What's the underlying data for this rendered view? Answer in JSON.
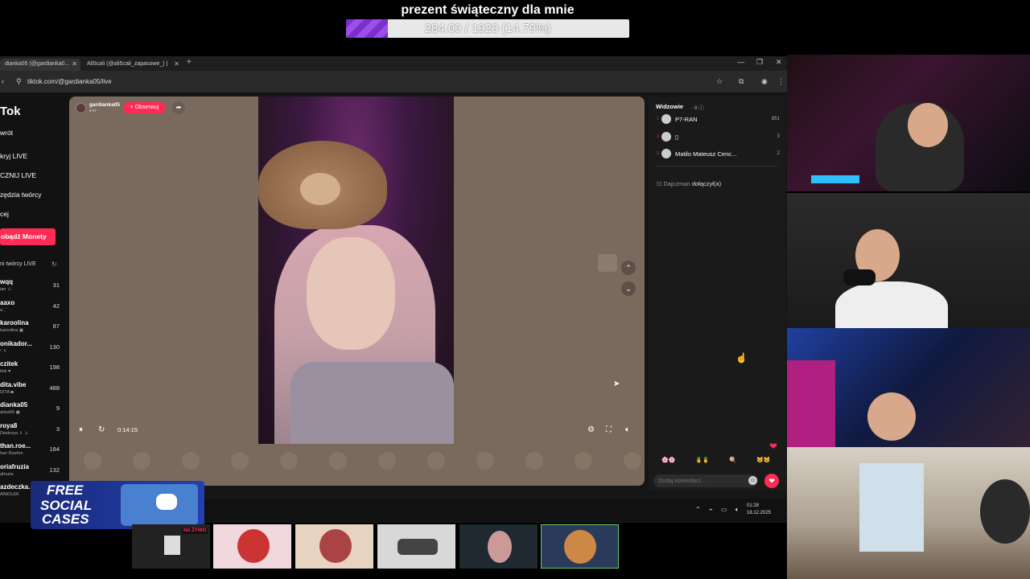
{
  "goal": {
    "title": "prezent świąteczny dla mnie",
    "text": "284.00 / 1920 (14.79%)",
    "progress": 0.1479
  },
  "browser": {
    "tabs": [
      {
        "label": "dianka05 (@gardianka0..."
      },
      {
        "label": "Ali5cali (@ali5cali_zapasowe_) |"
      }
    ],
    "url": "tiktok.com/@gardianka05/live"
  },
  "sidebar": {
    "logo": "Tok",
    "items": [
      {
        "label": "wrót"
      },
      {
        "label": "kryj LIVE"
      },
      {
        "label": "CZNIJ LIVE"
      },
      {
        "label": "zędzia twórcy"
      },
      {
        "label": "cej"
      }
    ],
    "coins_label": "obądź Monety",
    "creators_header": "ni twórcy LIVE",
    "creators": [
      {
        "name": "wqq",
        "sub": "ian ☺",
        "count": "31"
      },
      {
        "name": "aaxo",
        "sub": "a˙ꞈˇ",
        "count": "42"
      },
      {
        "name": "karoolina",
        "sub": "karoolina ▣",
        "count": "87"
      },
      {
        "name": "onikador...",
        "sub": "ᵒ ♗",
        "count": "130"
      },
      {
        "name": "czitek",
        "sub": "itek ♥",
        "count": "198"
      },
      {
        "name": "dita.vibe",
        "sub": "DITA ◙",
        "count": "488"
      },
      {
        "name": "dianka05",
        "sub": "anka05 ▣",
        "count": "9"
      },
      {
        "name": "roya8",
        "sub": "Destroya ♗ ☺",
        "count": "3"
      },
      {
        "name": "than.roe...",
        "sub": "han Roehm",
        "count": "184"
      },
      {
        "name": "oriafruzia",
        "sub": "afruzia",
        "count": "132"
      },
      {
        "name": "azdeczka...",
        "sub": "ANIOLEK",
        "count": ""
      }
    ]
  },
  "player": {
    "host_name": "gardianka05",
    "host_likes": "♥ 67",
    "follow_label": "+ Obserwuj",
    "timecode": "0:14:15"
  },
  "chat": {
    "viewers_label": "Widzowie",
    "viewers_count": "· 8 ⓘ",
    "viewers": [
      {
        "rank": "1",
        "name": "P7-RAN",
        "score": "851"
      },
      {
        "rank": "2",
        "name": "▯",
        "score": "3"
      },
      {
        "rank": "3",
        "name": "Matilo Mateusz Cenc...",
        "score": "2"
      }
    ],
    "join_user": "Dajczman",
    "join_text": "dołączył(a)",
    "comment_placeholder": "Dodaj komentarz...",
    "reactions": [
      "🌸🌸",
      "🍍🍍",
      "🍭",
      "🐱🐱"
    ]
  },
  "taskbar": {
    "time": "01:28",
    "date": "18.12.2025"
  },
  "promo": {
    "line1": "FREE",
    "line2": "SOCIAL",
    "line3": "CASES"
  },
  "thumb_badge": "NA ŻYWO",
  "colors": {
    "accent": "#fe2c55",
    "goal_fill": "#8a3fe0"
  }
}
